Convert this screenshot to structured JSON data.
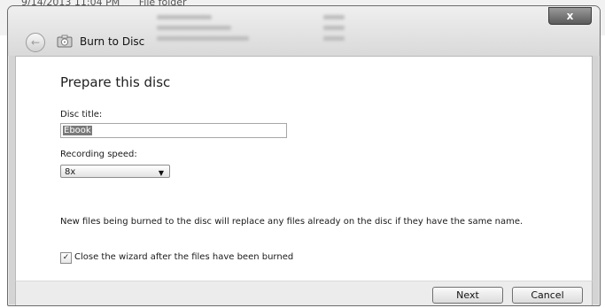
{
  "background": {
    "row_date": "9/14/2013 11:04 PM",
    "row_type": "File folder"
  },
  "window": {
    "title": "Burn to Disc",
    "close_glyph": "x",
    "back_glyph": "←"
  },
  "page": {
    "heading": "Prepare this disc",
    "disc_title_label": "Disc title:",
    "disc_title_value": "Ebook",
    "speed_label": "Recording speed:",
    "speed_value": "8x",
    "speed_caret": "▼",
    "note": "New files being burned to the disc will replace any files already on the disc if they have the same name.",
    "close_checkbox_checked": true,
    "close_checkbox_mark": "✓",
    "close_checkbox_label": "Close the wizard after the files have been burned"
  },
  "footer": {
    "next_label": "Next",
    "cancel_label": "Cancel"
  },
  "colors": {
    "accent": "#7a7a7a",
    "frame": "#d4d4d4",
    "content_bg": "#ffffff"
  }
}
